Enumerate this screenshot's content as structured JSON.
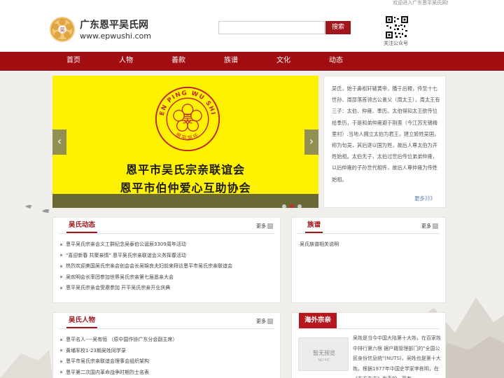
{
  "topbar": {
    "welcome": "欢迎进入广东恩平吴氏网!"
  },
  "header": {
    "logo": "logo-emblem",
    "site_title": "广东恩平吴氏网",
    "site_url": "www.epwushi.com",
    "search_placeholder": "",
    "search_button": "搜索",
    "qr_label": "关注公众号"
  },
  "nav": {
    "items": [
      {
        "label": "首页"
      },
      {
        "label": "人物"
      },
      {
        "label": "善款"
      },
      {
        "label": "族谱"
      },
      {
        "label": "文化"
      },
      {
        "label": "动态"
      }
    ]
  },
  "slider": {
    "emblem_text": "EN PING WU SHI",
    "emblem_char": "吴",
    "emblem_bottom": "恩平吴氏",
    "line1": "恩平市吴氏宗亲联谊会",
    "line2": "恩平市伯仲爱心互助协会",
    "prev_icon": "‹",
    "next_icon": "›",
    "dots": 3,
    "active_dot": 1
  },
  "intro": {
    "text": "吴氏，始于鼻祖轩辕黄帝，播于后稷，传至十七世孙、周部落首领古公亶父（周太王），周太王有三子：太伯、仲雍、季历。太伯得知太王欲传位给季历，于是和弟仲雍避于荆蛮（今江苏无锡梅里村）.当地人拥立太伯为君王，建立姬姓吴国，称为句吴，其后逐以国为姓，故后人尊太伯为开姓始祖。太伯无子，太伯过世后传位弟弟仲雍，以后仲雍的子孙世代相传，故后人尊仲雍为传姓始祖。",
    "more": "更多》》》"
  },
  "news": {
    "title": "吴氏动态",
    "more": "更多",
    "items": [
      "恩平吴氏宗亲会义工群纪念吴泰伯公诞辰3309周年活动",
      "\"喜迎新春 共聚亲情\" 恩平吴氏宗亲联谊会义务挥春活动",
      "热烈欢迎美国吴氏宗亲会创会会长吴锦良夫妇前来拜访恩平市吴氏宗亲联谊会",
      "吴欢明会长率团参加世界吴氏宗亲第七届恳亲大会",
      "恩平吴氏宗亲会受邀参加 开平吴氏宗亲开业庆典"
    ]
  },
  "genealogy": {
    "title": "族谱",
    "more": "更多",
    "text": "吴氏族谱相关说明"
  },
  "people": {
    "title": "吴氏人物",
    "more": "更多",
    "items": [
      "恩平名人----吴有恒 （原中国作协广东分会副主席）",
      "黄埔军校1-23期吴姓同学录",
      "恩平市吴氏宗亲联谊会理事会组织架构",
      "恩平第二次国内革命战争时期烈士名表"
    ]
  },
  "overseas": {
    "title": "海外宗亲",
    "nopic_line1": "暂无预览",
    "nopic_line2": "NO PIC",
    "text": "吴姓是当今中国大陆第十大姓，在百家姓中排行第六根 据户籍管理部门的\"全国公民身份信息统\"(NUTS)，吴姓也是第十大姓。根据1977年中国史学家李栋明，在《东方杂志》发表的一篇有"
  }
}
